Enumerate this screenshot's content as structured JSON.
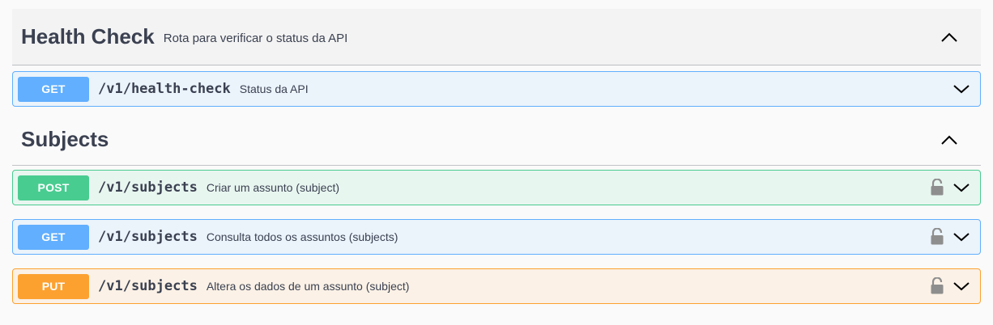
{
  "sections": [
    {
      "title": "Health Check",
      "description": "Rota para verificar o status da API",
      "collapse_icon": "chevron-up-icon",
      "operations": [
        {
          "method": "GET",
          "path": "/v1/health-check",
          "summary": "Status da API",
          "color": "#61affe",
          "locked": false
        }
      ]
    },
    {
      "title": "Subjects",
      "description": "",
      "collapse_icon": "chevron-up-icon",
      "operations": [
        {
          "method": "POST",
          "path": "/v1/subjects",
          "summary": "Criar um assunto (subject)",
          "color": "#49cc90",
          "locked": true,
          "lock_icon": "unlocked-padlock-icon"
        },
        {
          "method": "GET",
          "path": "/v1/subjects",
          "summary": "Consulta todos os assuntos (subjects)",
          "color": "#61affe",
          "locked": true,
          "lock_icon": "unlocked-padlock-icon"
        },
        {
          "method": "PUT",
          "path": "/v1/subjects",
          "summary": "Altera os dados de um assunto (subject)",
          "color": "#fca130",
          "locked": true,
          "lock_icon": "unlocked-padlock-icon"
        }
      ]
    }
  ]
}
